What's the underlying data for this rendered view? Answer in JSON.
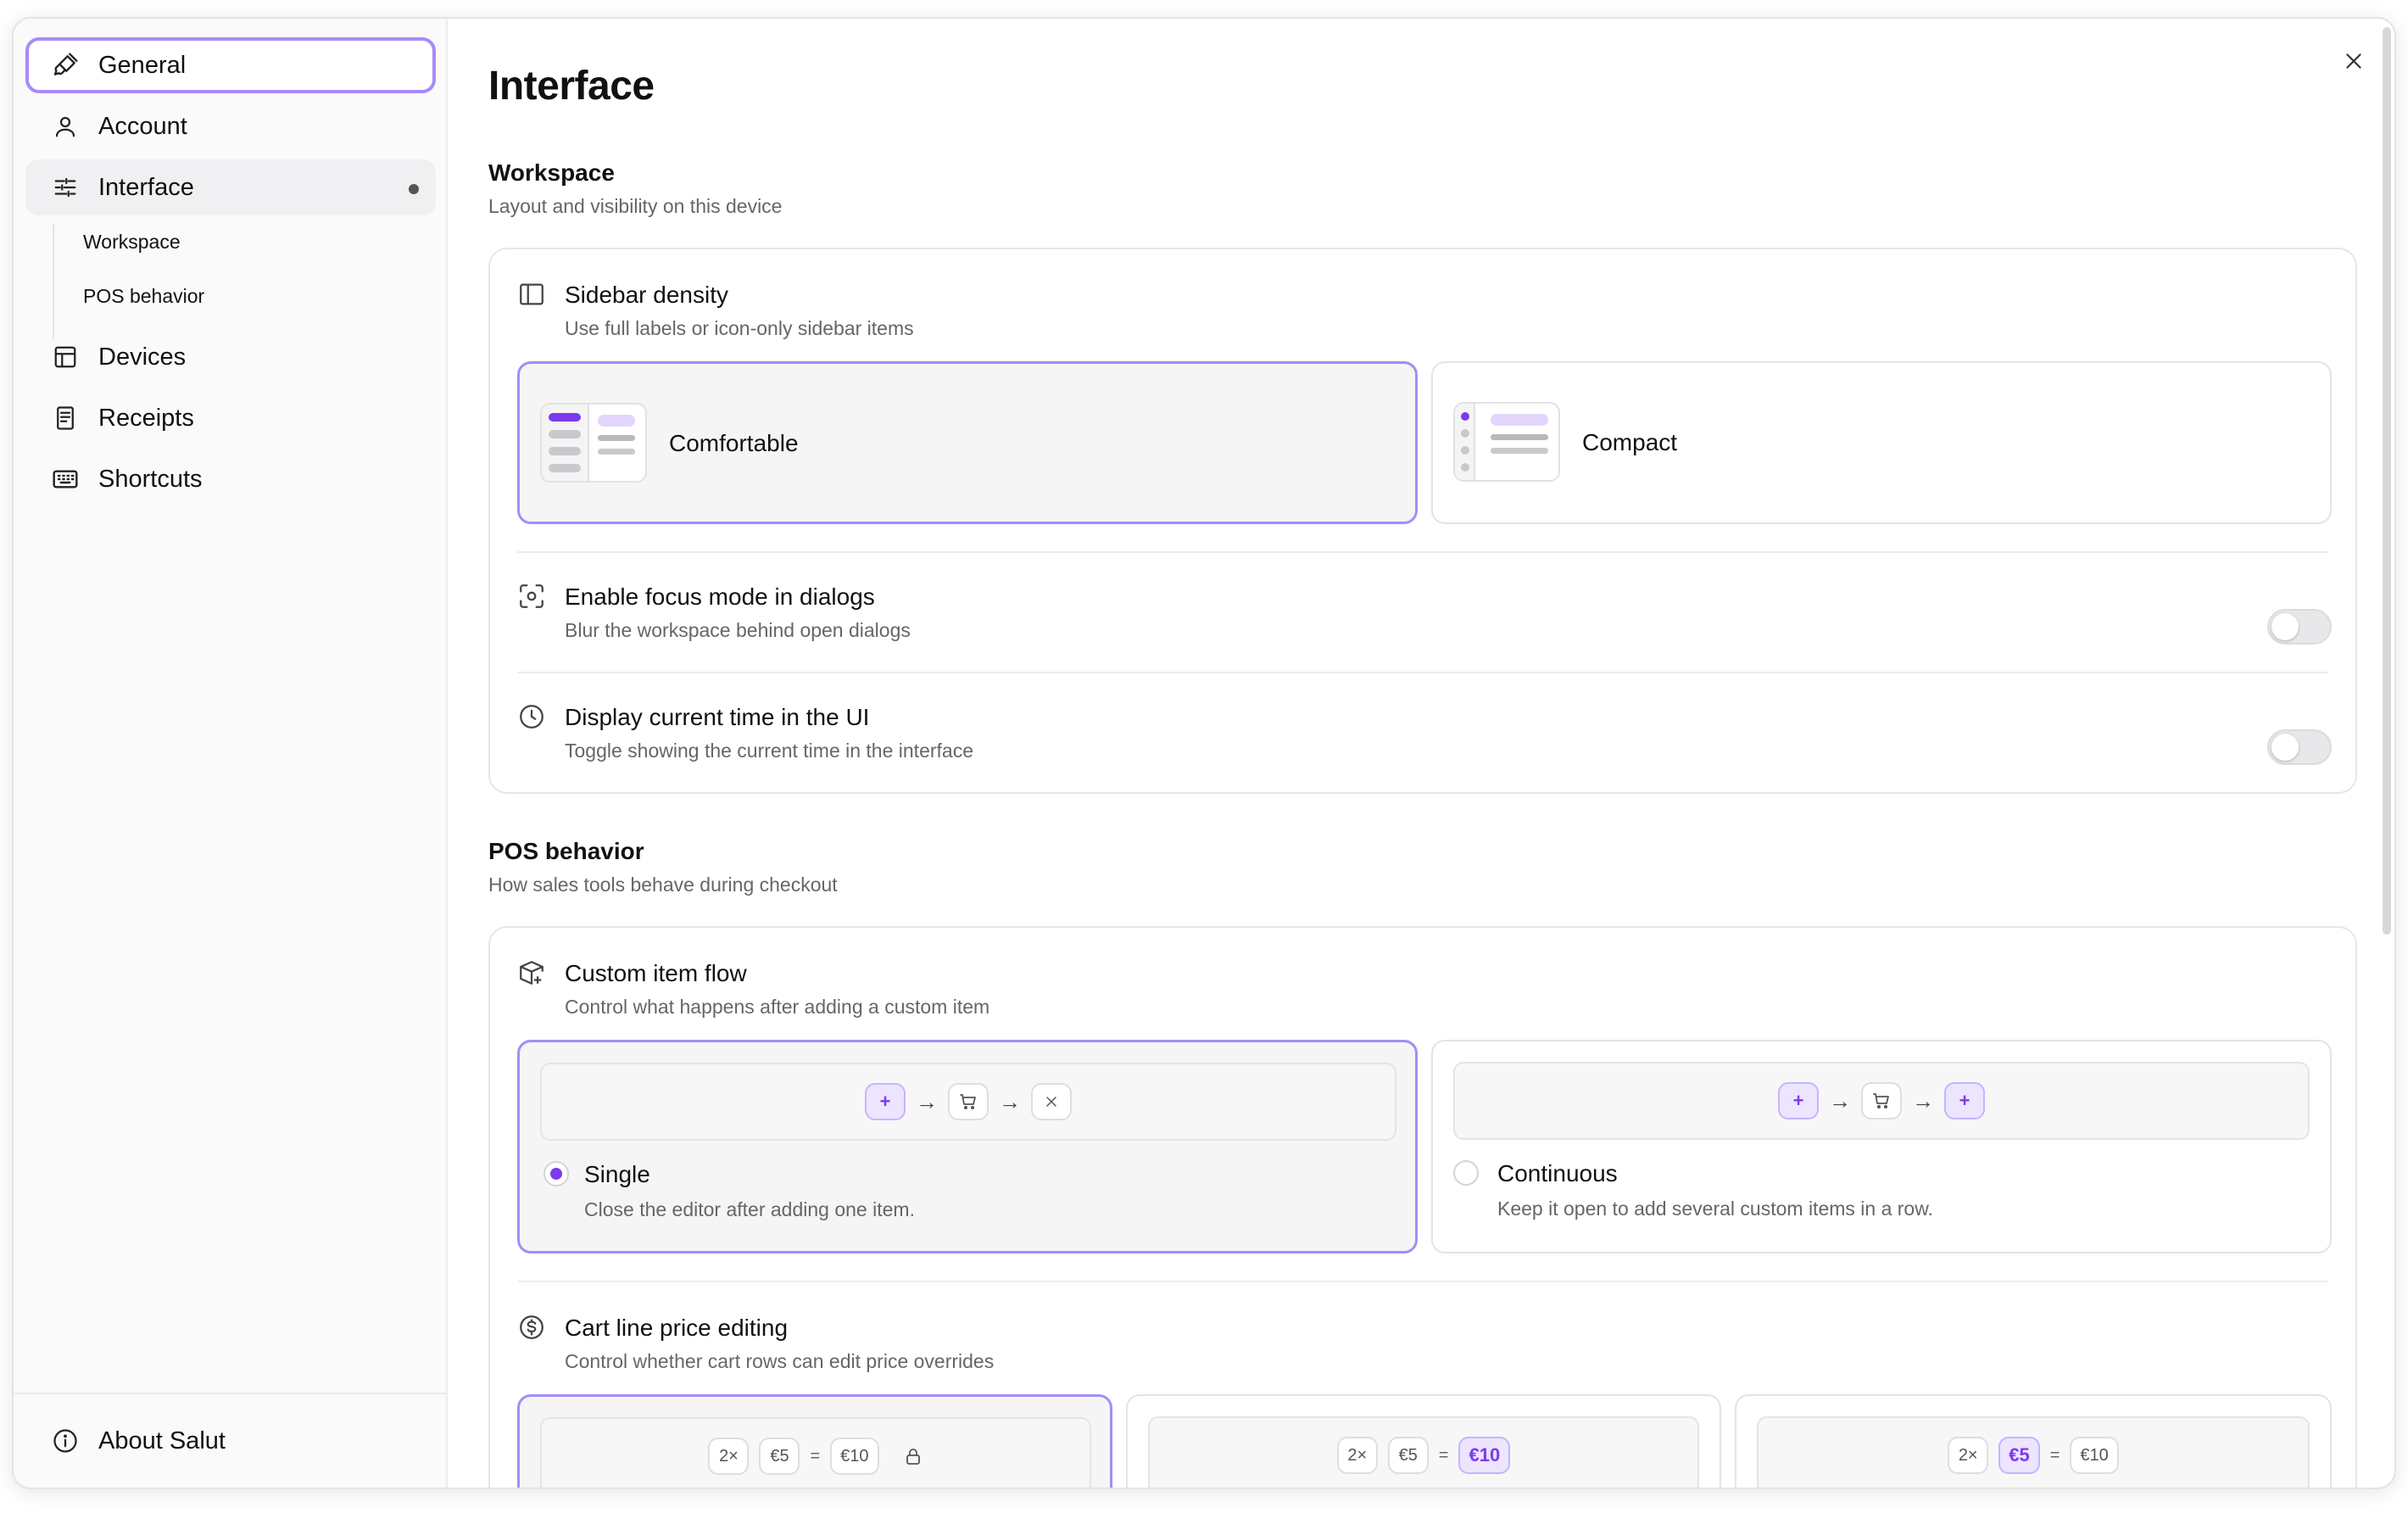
{
  "sidebar": {
    "items": [
      {
        "label": "General",
        "icon": "brush-icon"
      },
      {
        "label": "Account",
        "icon": "user-icon"
      },
      {
        "label": "Interface",
        "icon": "sliders-icon"
      },
      {
        "label": "Devices",
        "icon": "layout-icon"
      },
      {
        "label": "Receipts",
        "icon": "receipt-icon"
      },
      {
        "label": "Shortcuts",
        "icon": "keyboard-icon"
      }
    ],
    "subitems": [
      {
        "label": "Workspace"
      },
      {
        "label": "POS behavior"
      }
    ],
    "footer": {
      "label": "About Salut",
      "icon": "info-icon"
    }
  },
  "main": {
    "title": "Interface",
    "workspace": {
      "title": "Workspace",
      "description": "Layout and visibility on this device",
      "sidebar_density": {
        "title": "Sidebar density",
        "description": "Use full labels or icon-only sidebar items",
        "options": [
          {
            "label": "Comfortable",
            "selected": true
          },
          {
            "label": "Compact",
            "selected": false
          }
        ]
      },
      "focus_mode": {
        "title": "Enable focus mode in dialogs",
        "description": "Blur the workspace behind open dialogs",
        "enabled": false
      },
      "current_time": {
        "title": "Display current time in the UI",
        "description": "Toggle showing the current time in the interface",
        "enabled": false
      }
    },
    "pos_behavior": {
      "title": "POS behavior",
      "description": "How sales tools behave during checkout",
      "custom_item_flow": {
        "title": "Custom item flow",
        "description": "Control what happens after adding a custom item",
        "options": [
          {
            "label": "Single",
            "description": "Close the editor after adding one item.",
            "selected": true
          },
          {
            "label": "Continuous",
            "description": "Keep it open to add several custom items in a row.",
            "selected": false
          }
        ],
        "arrow_glyph": "→",
        "plus_glyph": "+"
      },
      "cart_line_price": {
        "title": "Cart line price editing",
        "description": "Control whether cart rows can edit price overrides",
        "chips": {
          "qty": "2×",
          "unit": "€5",
          "equals": "=",
          "total": "€10"
        }
      }
    }
  },
  "colors": {
    "accent": "#7c3aed",
    "accent_border": "#a78bfa",
    "accent_soft": "#ede4fe"
  }
}
